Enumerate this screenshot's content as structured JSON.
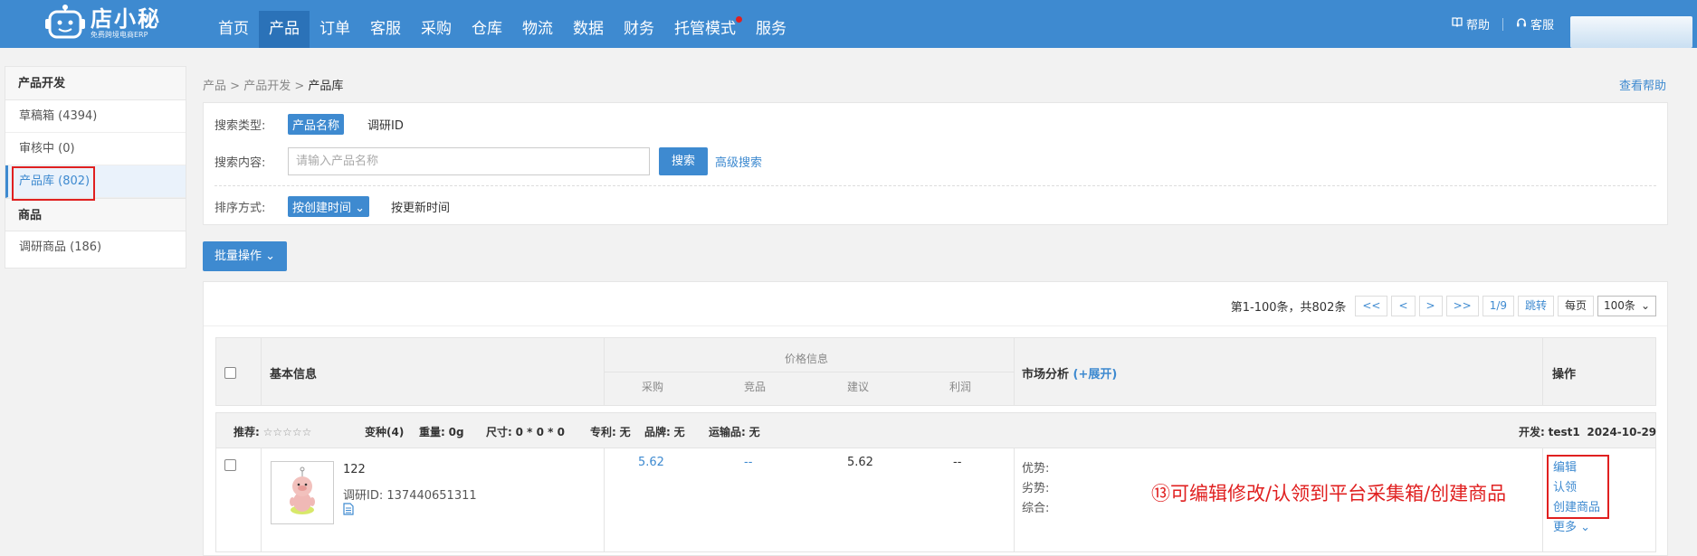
{
  "header": {
    "logo_name": "店小秘",
    "logo_sub": "免费跨境电商ERP",
    "nav": [
      {
        "label": "首页"
      },
      {
        "label": "产品",
        "active": true
      },
      {
        "label": "订单"
      },
      {
        "label": "客服"
      },
      {
        "label": "采购"
      },
      {
        "label": "仓库"
      },
      {
        "label": "物流"
      },
      {
        "label": "数据"
      },
      {
        "label": "财务"
      },
      {
        "label": "托管模式",
        "dot": true
      },
      {
        "label": "服务"
      }
    ],
    "help": "帮助",
    "service": "客服"
  },
  "sidebar": {
    "section1": "产品开发",
    "items1": [
      "草稿箱 (4394)",
      "审核中 (0)",
      "产品库 (802)"
    ],
    "section2": "商品",
    "items2": [
      "调研商品 (186)"
    ]
  },
  "breadcrumb": {
    "a": "产品",
    "b": "产品开发",
    "current": "产品库",
    "sep": ">"
  },
  "help_link": "查看帮助",
  "search": {
    "type_label": "搜索类型:",
    "type_selected": "产品名称",
    "type_other": "调研ID",
    "content_label": "搜索内容:",
    "placeholder": "请输入产品名称",
    "search_btn": "搜索",
    "advanced": "高级搜索",
    "sort_label": "排序方式:",
    "sort_selected": "按创建时间",
    "sort_other": "按更新时间"
  },
  "batch_btn": "批量操作",
  "pager": {
    "info": "第1-100条，共802条",
    "first": "<<",
    "prev": "<",
    "next": ">",
    "last": ">>",
    "page": "1/9",
    "jump": "跳转",
    "per_page_label": "每页",
    "per_page": "100条"
  },
  "table": {
    "col_basic": "基本信息",
    "col_price": "价格信息",
    "price_sub": [
      "采购",
      "竞品",
      "建议",
      "利润"
    ],
    "col_market": "市场分析",
    "expand": "(+展开)",
    "col_ops": "操作"
  },
  "meta": {
    "recommend_label": "推荐:",
    "stars": "☆☆☆☆☆",
    "variants": "变种(4)",
    "weight_label": "重量:",
    "weight": "0g",
    "size_label": "尺寸:",
    "size": "0 * 0 * 0",
    "patent_label": "专利:",
    "patent": "无",
    "brand_label": "品牌:",
    "brand": "无",
    "transport_label": "运输品:",
    "transport": "无",
    "dev_label": "开发:",
    "dev": "test1",
    "date": "2024-10-29"
  },
  "product": {
    "name": "122",
    "research_id_label": "调研ID:",
    "research_id": "137440651311",
    "purchase": "5.62",
    "competitor": "--",
    "suggest": "5.62",
    "profit": "--",
    "adv": "优势:",
    "dis": "劣势:",
    "overall": "综合:",
    "ops": [
      "编辑",
      "认领",
      "创建商品",
      "更多"
    ]
  },
  "annotation": "⑬可编辑修改/认领到平台采集箱/创建商品"
}
